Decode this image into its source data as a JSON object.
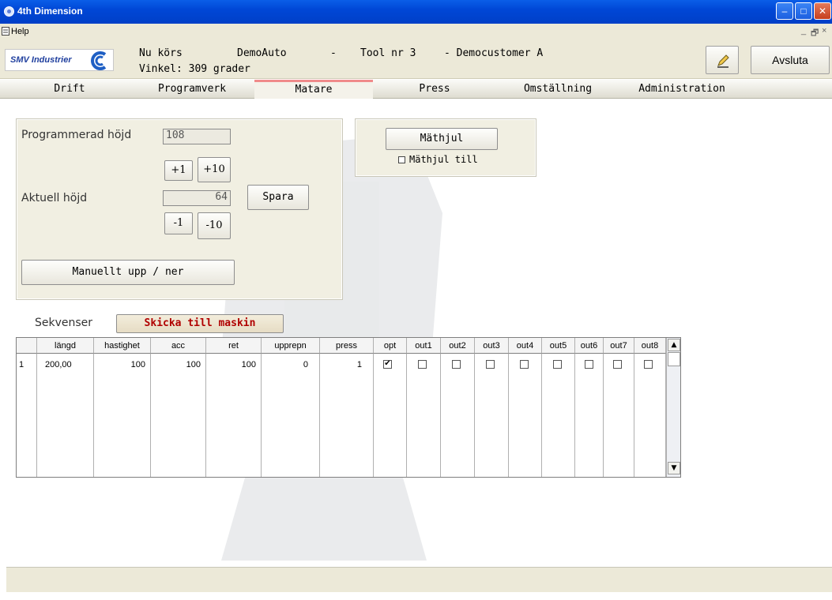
{
  "window": {
    "title": "4th Dimension",
    "min": "–",
    "max": "□",
    "close": "✕"
  },
  "menu": {
    "help": "Help",
    "mdi_min": "_",
    "mdi_restore": "🗗",
    "mdi_close": "×"
  },
  "header": {
    "logo_text": "SMV Industrier",
    "running_label": "Nu körs",
    "program": "DemoAuto",
    "dash1": "-",
    "tool": "Tool nr 3",
    "customer": "- Democustomer A",
    "angle": "Vinkel: 309 grader",
    "quit": "Avsluta"
  },
  "tabs": [
    {
      "label": "Drift"
    },
    {
      "label": "Programverk"
    },
    {
      "label": "Matare"
    },
    {
      "label": "Press"
    },
    {
      "label": "Omställning"
    },
    {
      "label": "Administration"
    }
  ],
  "height_panel": {
    "programmed_label": "Programmerad höjd",
    "programmed_value": "108",
    "plus1": "+1",
    "plus10": "+10",
    "actual_label": "Aktuell höjd",
    "actual_value": "64",
    "save": "Spara",
    "minus1": "-1",
    "minus10": "-10",
    "manual": "Manuellt upp / ner"
  },
  "wheel_panel": {
    "button": "Mäthjul",
    "checkbox_label": "Mäthjul till"
  },
  "sequences": {
    "label": "Sekvenser",
    "send": "Skicka till maskin",
    "columns": [
      "",
      "längd",
      "hastighet",
      "acc",
      "ret",
      "upprepn",
      "press",
      "opt",
      "out1",
      "out2",
      "out3",
      "out4",
      "out5",
      "out6",
      "out7",
      "out8"
    ],
    "rows": [
      {
        "idx": "1",
        "langd": "200,00",
        "hastighet": "100",
        "acc": "100",
        "ret": "100",
        "upprepn": "0",
        "press": "1",
        "opt": "✔",
        "out1": "",
        "out2": "",
        "out3": "",
        "out4": "",
        "out5": "",
        "out6": "",
        "out7": "",
        "out8": ""
      }
    ],
    "scroll_up": "▲",
    "scroll_down": "▼"
  },
  "colors": {
    "accent_tab": "#f08a8a",
    "send_text": "#b00000",
    "logo_blue": "#1f3f9e"
  },
  "icons": {
    "app": "app-icon",
    "edit": "pencil-icon"
  }
}
